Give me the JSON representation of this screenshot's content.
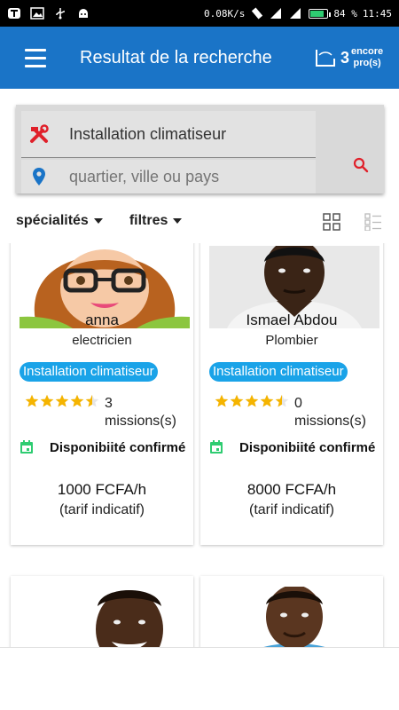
{
  "status_bar": {
    "network_speed": "0.08K/s",
    "battery_percent": "84 %",
    "battery_level": 0.84,
    "time": "11:45"
  },
  "app_bar": {
    "title": "Resultat de la recherche",
    "credit_count": "3",
    "credit_label_line1": "encore",
    "credit_label_line2": "pro(s)"
  },
  "search": {
    "specialty_value": "Installation climatiseur",
    "location_placeholder": "quartier, ville ou pays"
  },
  "filters": {
    "specialties_label": "spécialités",
    "filters_label": "filtres"
  },
  "colors": {
    "primary": "#1a74c7",
    "tag": "#1aa3e8",
    "accent_red": "#e0202a",
    "star": "#f5b400",
    "calendar_green": "#2ecc71"
  },
  "results": [
    {
      "name": "anna",
      "role": "electricien",
      "tag": "Installation climatiseur",
      "rating": 4.5,
      "missions_count": "3",
      "missions_label": "missions(s)",
      "availability": "Disponibiité confirmé",
      "price": "1000 FCFA/h",
      "price_note": "(tarif indicatif)"
    },
    {
      "name": "Ismael Abdou",
      "role": "Plombier",
      "tag": "Installation climatiseur",
      "rating": 4.5,
      "missions_count": "0",
      "missions_label": "missions(s)",
      "availability": "Disponibiité confirmé",
      "price": "8000 FCFA/h",
      "price_note": "(tarif indicatif)"
    }
  ]
}
